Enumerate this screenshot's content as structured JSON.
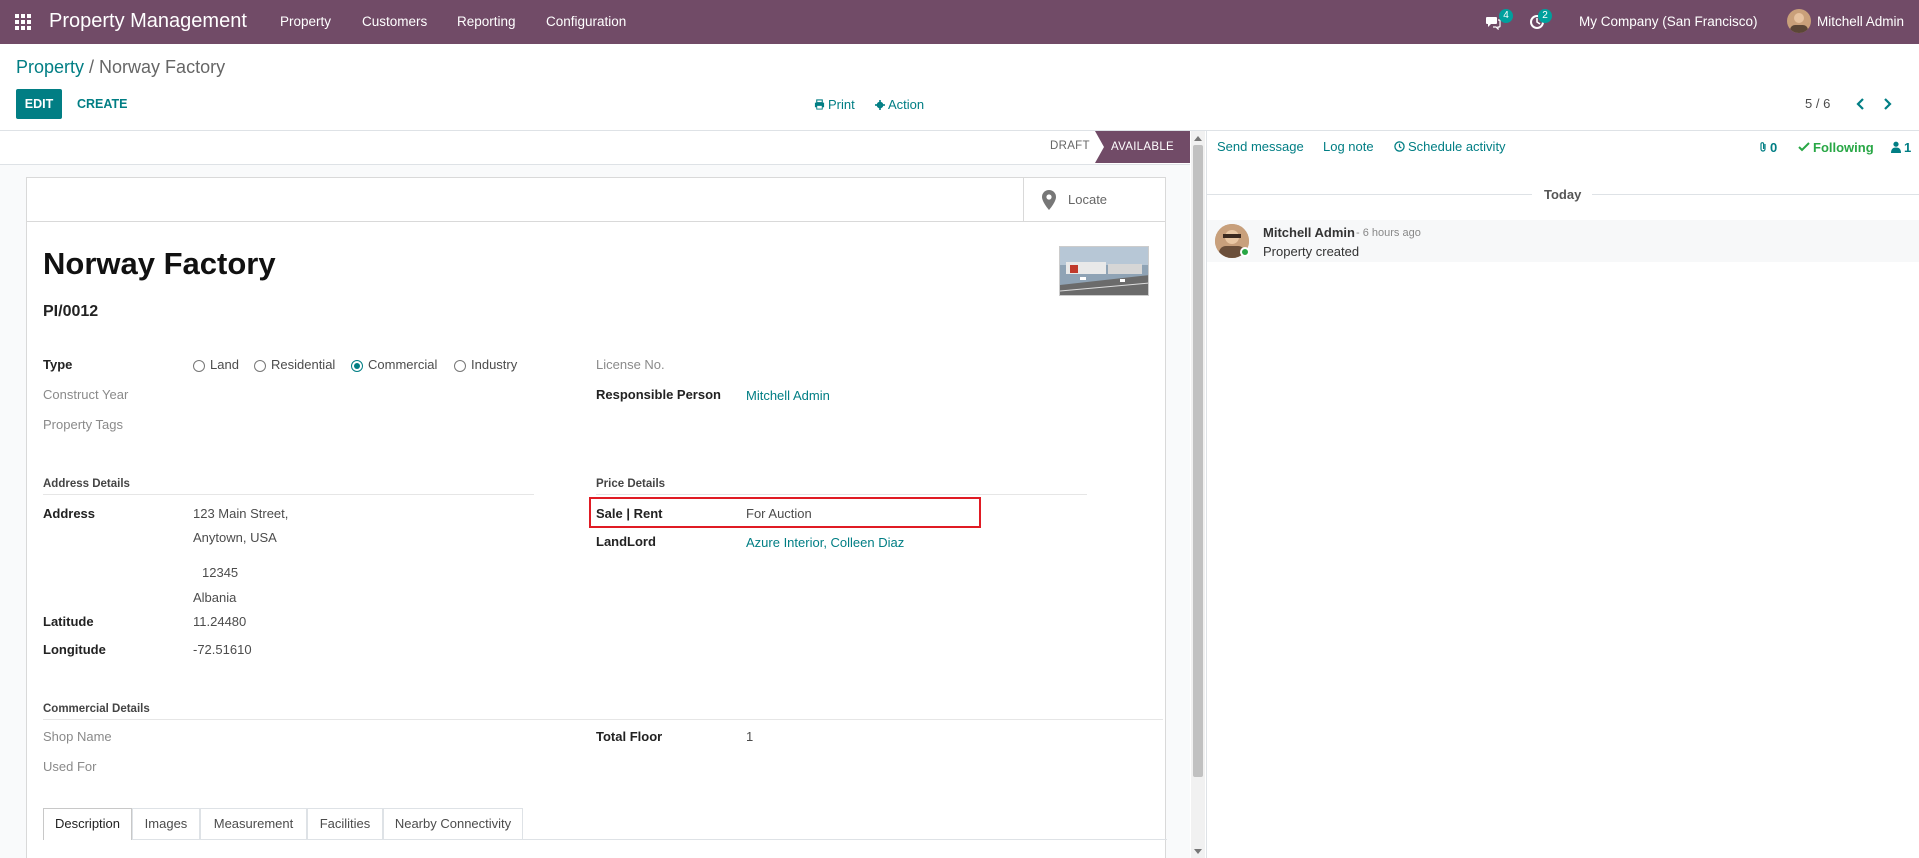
{
  "navbar": {
    "app_name": "Property Management",
    "menus": [
      "Property",
      "Customers",
      "Reporting",
      "Configuration"
    ],
    "messages_count": "4",
    "activities_count": "2",
    "company": "My Company (San Francisco)",
    "user": "Mitchell Admin"
  },
  "breadcrumb": {
    "parent": "Property",
    "separator": " / ",
    "current": "Norway Factory"
  },
  "control": {
    "edit": "EDIT",
    "create": "CREATE",
    "print": "Print",
    "action": "Action",
    "pager": "5 / 6"
  },
  "status": {
    "stages": [
      "DRAFT",
      "AVAILABLE"
    ],
    "current": "AVAILABLE"
  },
  "form": {
    "locate": "Locate",
    "name": "Norway Factory",
    "code": "PI/0012",
    "type_label": "Type",
    "type_options": [
      "Land",
      "Residential",
      "Commercial",
      "Industry"
    ],
    "type_selected": "Commercial",
    "construct_year_label": "Construct Year",
    "property_tags_label": "Property Tags",
    "license_label": "License No.",
    "responsible_label": "Responsible Person",
    "responsible_value": "Mitchell Admin",
    "address_section": "Address Details",
    "address_label": "Address",
    "street": "123 Main Street,",
    "city": "Anytown, USA",
    "zip": "12345",
    "country": "Albania",
    "latitude_label": "Latitude",
    "latitude": "11.24480",
    "longitude_label": "Longitude",
    "longitude": "-72.51610",
    "price_section": "Price Details",
    "sale_rent_label": "Sale | Rent",
    "sale_rent_value": "For Auction",
    "landlord_label": "LandLord",
    "landlord_value": "Azure Interior, Colleen Diaz",
    "commercial_section": "Commercial Details",
    "shop_name_label": "Shop Name",
    "used_for_label": "Used For",
    "total_floor_label": "Total Floor",
    "total_floor": "1",
    "tabs": [
      "Description",
      "Images",
      "Measurement",
      "Facilities",
      "Nearby Connectivity"
    ],
    "active_tab": "Description"
  },
  "chatter": {
    "send_message": "Send message",
    "log_note": "Log note",
    "schedule_activity": "Schedule activity",
    "attachments": "0",
    "following": "Following",
    "followers": "1",
    "date_separator": "Today",
    "messages": [
      {
        "author": "Mitchell Admin",
        "time": "- 6 hours ago",
        "body": "Property created"
      }
    ]
  },
  "colors": {
    "brand": "#714b67",
    "accent": "#017e84",
    "highlight": "#e01b24"
  }
}
